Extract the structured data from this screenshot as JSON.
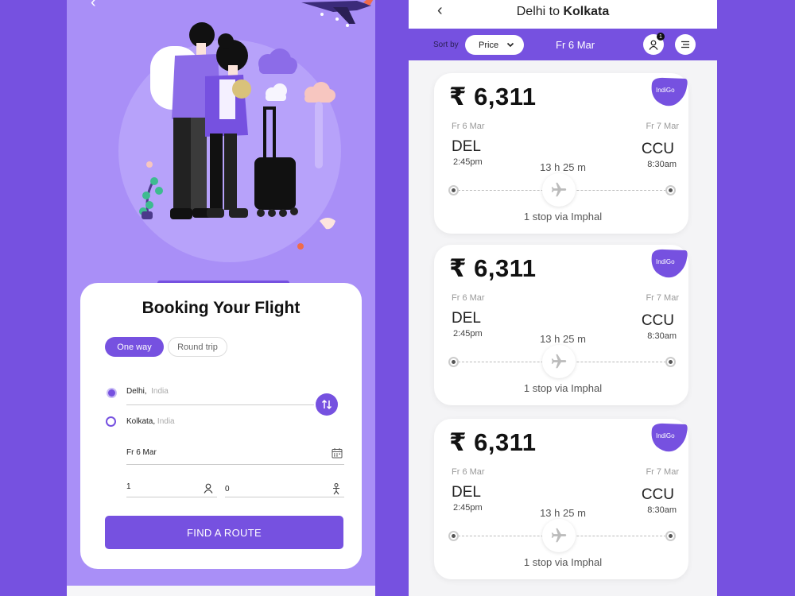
{
  "booking": {
    "title": "Booking Your Flight",
    "trip_types": [
      "One way",
      "Round trip"
    ],
    "from": {
      "city": "Delhi,",
      "country": "India"
    },
    "to": {
      "city": "Kolkata,",
      "country": "India"
    },
    "date": "Fr 6 Mar",
    "adults": "1",
    "children": "0",
    "find_button": "FIND A ROUTE"
  },
  "results": {
    "title_from": "Delhi to ",
    "title_to": "Kolkata",
    "sort_label": "Sort by",
    "sort_value": "Price",
    "date": "Fr 6 Mar",
    "user_badge": "1",
    "flights": [
      {
        "price": "₹ 6,311",
        "airline": "IndiGo",
        "dep_date": "Fr 6 Mar",
        "arr_date": "Fr 7 Mar",
        "from": "DEL",
        "to": "CCU",
        "dep_time": "2:45pm",
        "arr_time": "8:30am",
        "duration": "13 h 25 m",
        "stops": "1 stop via Imphal"
      },
      {
        "price": "₹ 6,311",
        "airline": "IndiGo",
        "dep_date": "Fr 6 Mar",
        "arr_date": "Fr 7 Mar",
        "from": "DEL",
        "to": "CCU",
        "dep_time": "2:45pm",
        "arr_time": "8:30am",
        "duration": "13 h 25 m",
        "stops": "1 stop via Imphal"
      },
      {
        "price": "₹ 6,311",
        "airline": "IndiGo",
        "dep_date": "Fr 6 Mar",
        "arr_date": "Fr 7 Mar",
        "from": "DEL",
        "to": "CCU",
        "dep_time": "2:45pm",
        "arr_time": "8:30am",
        "duration": "13 h 25 m",
        "stops": "1 stop via Imphal"
      }
    ]
  },
  "colors": {
    "accent": "#7651e0",
    "light_accent": "#a98ff7",
    "background": "#f4f4f6"
  }
}
